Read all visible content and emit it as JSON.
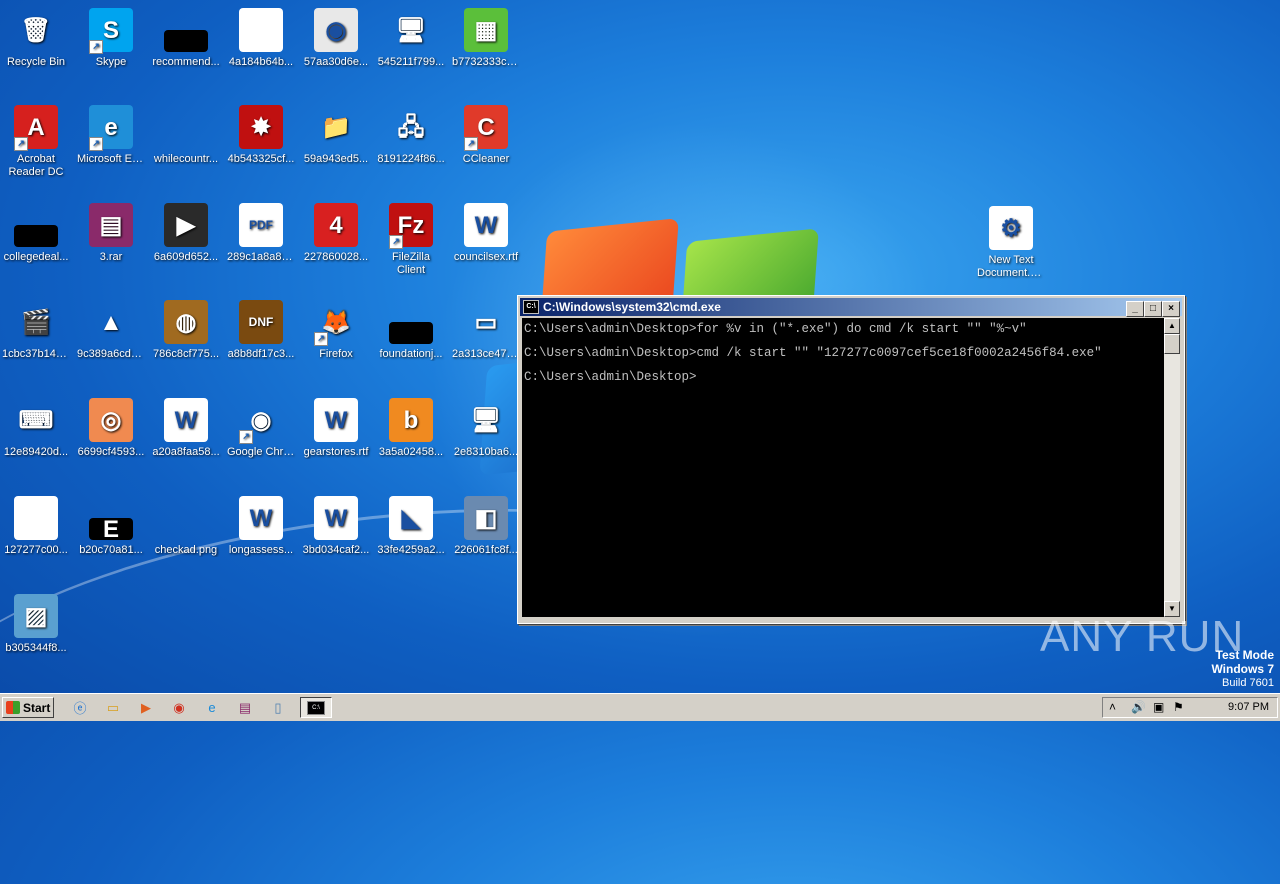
{
  "desktop": {
    "icons": [
      {
        "id": "recycle",
        "label": "Recycle Bin",
        "glyph": "🗑",
        "bg": "transparent"
      },
      {
        "id": "skype",
        "label": "Skype",
        "glyph": "S",
        "bg": "#00a4ef"
      },
      {
        "id": "recommend",
        "label": "recommend...",
        "glyph": "",
        "bg": "#000000"
      },
      {
        "id": "4a184b64",
        "label": "4a184b64b...",
        "glyph": "",
        "bg": "#ffffff"
      },
      {
        "id": "57aa30d6",
        "label": "57aa30d6e...",
        "glyph": "◉",
        "bg": "#e8e8e8"
      },
      {
        "id": "545211f7",
        "label": "545211f799...",
        "glyph": "🖥",
        "bg": "transparent"
      },
      {
        "id": "b7732333",
        "label": "b7732333c6...",
        "glyph": "▦",
        "bg": "#5bbf3a"
      },
      {
        "id": "acrobat",
        "label": "Acrobat Reader DC",
        "glyph": "A",
        "bg": "#d6201e"
      },
      {
        "id": "edge",
        "label": "Microsoft Edge",
        "glyph": "e",
        "bg": "#1f8fd8"
      },
      {
        "id": "whilecountr",
        "label": "whilecountr...",
        "glyph": "",
        "bg": "transparent"
      },
      {
        "id": "4b543325",
        "label": "4b543325cf...",
        "glyph": "✸",
        "bg": "#c01010"
      },
      {
        "id": "59a943ed",
        "label": "59a943ed5...",
        "glyph": "📁",
        "bg": "transparent"
      },
      {
        "id": "8191224f",
        "label": "8191224f86...",
        "glyph": "🖧",
        "bg": "transparent"
      },
      {
        "id": "ccleaner",
        "label": "CCleaner",
        "glyph": "C",
        "bg": "#e03a2a"
      },
      {
        "id": "collegedeal",
        "label": "collegedeal...",
        "glyph": "",
        "bg": "#000000"
      },
      {
        "id": "3rar",
        "label": "3.rar",
        "glyph": "▤",
        "bg": "#8a2a6a"
      },
      {
        "id": "6a609d65",
        "label": "6a609d652...",
        "glyph": "▶",
        "bg": "#2a2a2a"
      },
      {
        "id": "289c1a8a",
        "label": "289c1a8a89...",
        "glyph": "PDF",
        "bg": "#ffffff"
      },
      {
        "id": "22786002",
        "label": "227860028...",
        "glyph": "4",
        "bg": "#d82020"
      },
      {
        "id": "filezilla",
        "label": "FileZilla Client",
        "glyph": "Fz",
        "bg": "#c01010"
      },
      {
        "id": "councilsex",
        "label": "councilsex.rtf",
        "glyph": "W",
        "bg": "#ffffff"
      },
      {
        "id": "1cbc37b1",
        "label": "1cbc37b142...",
        "glyph": "🎬",
        "bg": "transparent"
      },
      {
        "id": "9c389a6c",
        "label": "9c389a6cd4...",
        "glyph": "▲",
        "bg": "transparent"
      },
      {
        "id": "786c8cf7",
        "label": "786c8cf775...",
        "glyph": "◍",
        "bg": "#a06a20"
      },
      {
        "id": "a8b8df17",
        "label": "a8b8df17c3...",
        "glyph": "DNF",
        "bg": "#7a4a10"
      },
      {
        "id": "firefox",
        "label": "Firefox",
        "glyph": "🦊",
        "bg": "transparent"
      },
      {
        "id": "foundationj",
        "label": "foundationj...",
        "glyph": "",
        "bg": "#000000"
      },
      {
        "id": "2a313ce4",
        "label": "2a313ce479...",
        "glyph": "▭",
        "bg": "transparent"
      },
      {
        "id": "12e89420",
        "label": "12e89420d...",
        "glyph": "⌨",
        "bg": "transparent"
      },
      {
        "id": "6699cf45",
        "label": "6699cf4593...",
        "glyph": "◎",
        "bg": "#f08a50"
      },
      {
        "id": "a20a8faa",
        "label": "a20a8faa58...",
        "glyph": "W",
        "bg": "#ffffff"
      },
      {
        "id": "chrome",
        "label": "Google Chrome",
        "glyph": "◉",
        "bg": "transparent"
      },
      {
        "id": "gearstores",
        "label": "gearstores.rtf",
        "glyph": "W",
        "bg": "#ffffff"
      },
      {
        "id": "3a5a0245",
        "label": "3a5a02458...",
        "glyph": "b",
        "bg": "#f08a20"
      },
      {
        "id": "2e8310ba",
        "label": "2e8310ba6...",
        "glyph": "🖥",
        "bg": "transparent"
      },
      {
        "id": "127277c0",
        "label": "127277c00...",
        "glyph": "",
        "bg": "#ffffff"
      },
      {
        "id": "b20c70a8",
        "label": "b20c70a81...",
        "glyph": "E",
        "bg": "#000000"
      },
      {
        "id": "checkad",
        "label": "checkad.png",
        "glyph": "",
        "bg": "transparent"
      },
      {
        "id": "longassess",
        "label": "longassess...",
        "glyph": "W",
        "bg": "#ffffff"
      },
      {
        "id": "3bd034ca",
        "label": "3bd034caf2...",
        "glyph": "W",
        "bg": "#ffffff"
      },
      {
        "id": "33fe4259",
        "label": "33fe4259a2...",
        "glyph": "◣",
        "bg": "#ffffff"
      },
      {
        "id": "226061fc",
        "label": "226061fc8f...",
        "glyph": "◧",
        "bg": "#6a8ab0"
      },
      {
        "id": "b305344f",
        "label": "b305344f8...",
        "glyph": "▨",
        "bg": "#5aa0d0"
      },
      {
        "id": "newtext",
        "label": "New Text Document.bat",
        "glyph": "⚙",
        "bg": "#ffffff"
      }
    ]
  },
  "cmd": {
    "title": "C:\\Windows\\system32\\cmd.exe",
    "lines": [
      "C:\\Users\\admin\\Desktop>for %v in (\"*.exe\") do cmd /k start \"\" \"%~v\"",
      "C:\\Users\\admin\\Desktop>cmd /k start \"\" \"127277c0097cef5ce18f0002a2456f84.exe\"",
      "C:\\Users\\admin\\Desktop>"
    ],
    "minimize_glyph": "_",
    "maximize_glyph": "□",
    "close_glyph": "×"
  },
  "taskbar": {
    "start_label": "Start",
    "clock": "9:07 PM"
  },
  "watermark": "ANY RUN",
  "testmode": {
    "line1": "Test Mode",
    "line2": "Windows 7",
    "line3": "Build 7601"
  }
}
